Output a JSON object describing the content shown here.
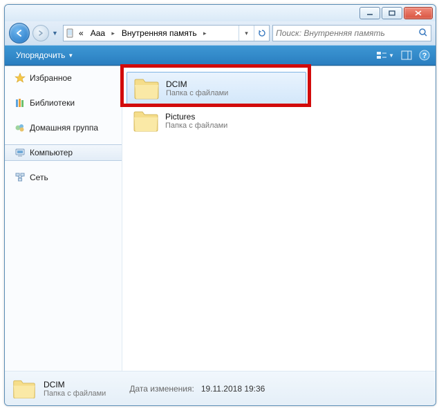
{
  "titlebar": {},
  "nav": {
    "breadcrumb_prefix": "«",
    "breadcrumb": [
      "Aaa",
      "Внутренняя память"
    ],
    "search_placeholder": "Поиск: Внутренняя память"
  },
  "toolbar": {
    "organize": "Упорядочить"
  },
  "sidebar": {
    "favorites": "Избранное",
    "libraries": "Библиотеки",
    "homegroup": "Домашняя группа",
    "computer": "Компьютер",
    "network": "Сеть"
  },
  "content": {
    "items": [
      {
        "name": "DCIM",
        "desc": "Папка с файлами",
        "selected": true
      },
      {
        "name": "Pictures",
        "desc": "Папка с файлами",
        "selected": false
      }
    ]
  },
  "details": {
    "name": "DCIM",
    "desc": "Папка с файлами",
    "modified_label": "Дата изменения:",
    "modified_value": "19.11.2018 19:36"
  }
}
